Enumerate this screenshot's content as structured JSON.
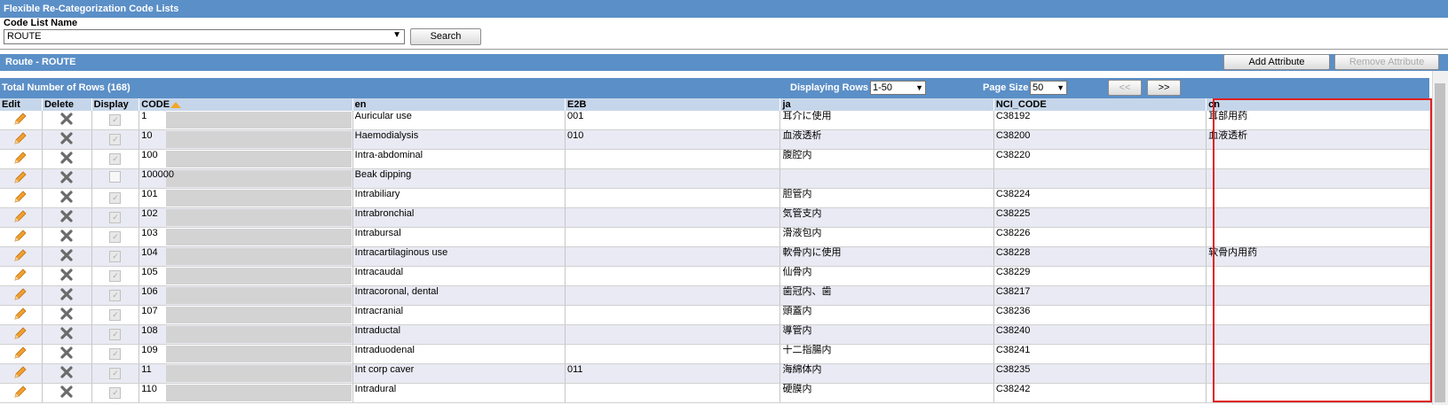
{
  "window": {
    "title": "Flexible Re-Categorization Code Lists"
  },
  "filter": {
    "label": "Code List Name",
    "selected": "ROUTE",
    "search_label": "Search"
  },
  "section": {
    "title": "Route - ROUTE",
    "add_attribute": "Add Attribute",
    "remove_attribute": "Remove Attribute"
  },
  "status": {
    "total": "Total Number of Rows (168)",
    "displaying_label": "Displaying Rows",
    "displaying_value": "1-50",
    "page_size_label": "Page Size",
    "page_size_value": "50",
    "prev": "<<",
    "next": ">>"
  },
  "columns": [
    "Edit",
    "Delete",
    "Display",
    "CODE",
    "en",
    "E2B",
    "ja",
    "NCI_CODE",
    "cn"
  ],
  "rows": [
    {
      "code": "1",
      "en": "Auricular use",
      "e2b": "001",
      "ja": "耳介に使用",
      "nci": "C38192",
      "cn": "耳部用药",
      "display": true
    },
    {
      "code": "10",
      "en": "Haemodialysis",
      "e2b": "010",
      "ja": "血液透析",
      "nci": "C38200",
      "cn": "血液透析",
      "display": true
    },
    {
      "code": "100",
      "en": "Intra-abdominal",
      "e2b": "",
      "ja": "腹腔内",
      "nci": "C38220",
      "cn": "",
      "display": true
    },
    {
      "code": "100000",
      "en": "Beak dipping",
      "e2b": "",
      "ja": "",
      "nci": "",
      "cn": "",
      "display": false
    },
    {
      "code": "101",
      "en": "Intrabiliary",
      "e2b": "",
      "ja": "胆管内",
      "nci": "C38224",
      "cn": "",
      "display": true
    },
    {
      "code": "102",
      "en": "Intrabronchial",
      "e2b": "",
      "ja": "気管支内",
      "nci": "C38225",
      "cn": "",
      "display": true
    },
    {
      "code": "103",
      "en": "Intrabursal",
      "e2b": "",
      "ja": "滑液包内",
      "nci": "C38226",
      "cn": "",
      "display": true
    },
    {
      "code": "104",
      "en": "Intracartilaginous use",
      "e2b": "",
      "ja": "軟骨内に使用",
      "nci": "C38228",
      "cn": "软骨内用药",
      "display": true
    },
    {
      "code": "105",
      "en": "Intracaudal",
      "e2b": "",
      "ja": "仙骨内",
      "nci": "C38229",
      "cn": "",
      "display": true
    },
    {
      "code": "106",
      "en": "Intracoronal, dental",
      "e2b": "",
      "ja": "歯冠内、歯",
      "nci": "C38217",
      "cn": "",
      "display": true
    },
    {
      "code": "107",
      "en": "Intracranial",
      "e2b": "",
      "ja": "頭蓋内",
      "nci": "C38236",
      "cn": "",
      "display": true
    },
    {
      "code": "108",
      "en": "Intraductal",
      "e2b": "",
      "ja": "導管内",
      "nci": "C38240",
      "cn": "",
      "display": true
    },
    {
      "code": "109",
      "en": "Intraduodenal",
      "e2b": "",
      "ja": "十二指腸内",
      "nci": "C38241",
      "cn": "",
      "display": true
    },
    {
      "code": "11",
      "en": "Int corp caver",
      "e2b": "011",
      "ja": "海綿体内",
      "nci": "C38235",
      "cn": "",
      "display": true
    },
    {
      "code": "110",
      "en": "Intradural",
      "e2b": "",
      "ja": "硬膜内",
      "nci": "C38242",
      "cn": "",
      "display": true
    }
  ],
  "icons": {
    "edit": "pencil-icon",
    "delete": "x-icon",
    "display": "checkbox-icon",
    "sort": "sort-asc-icon"
  },
  "colors": {
    "header_bar": "#5b8fc7",
    "column_header": "#c6d6ea",
    "highlight": "#e02020",
    "pencil": "#f0a030"
  }
}
